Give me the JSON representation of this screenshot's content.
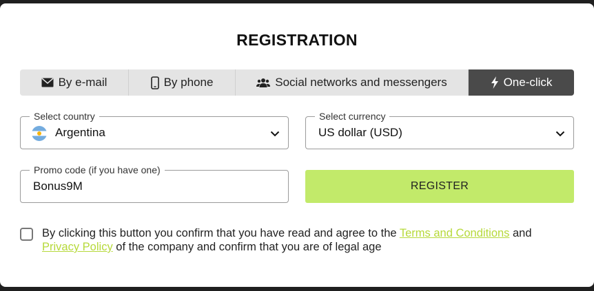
{
  "modal": {
    "title": "REGISTRATION"
  },
  "tabs": [
    {
      "label": "By e-mail",
      "icon": "envelope-icon"
    },
    {
      "label": "By phone",
      "icon": "phone-icon"
    },
    {
      "label": "Social networks and messengers",
      "icon": "users-icon"
    },
    {
      "label": "One-click",
      "icon": "lightning-icon",
      "active": true
    }
  ],
  "form": {
    "country": {
      "label": "Select country",
      "value": "Argentina",
      "flag": "argentina-flag-icon"
    },
    "currency": {
      "label": "Select currency",
      "value": "US dollar (USD)"
    },
    "promo": {
      "label": "Promo code (if you have one)",
      "value": "Bonus9M"
    },
    "register_label": "REGISTER"
  },
  "agreement": {
    "checked": false,
    "text_before": "By clicking this button you confirm that you have read and agree to the ",
    "terms_link": "Terms and Conditions",
    "text_and": " and ",
    "privacy_link": "Privacy Policy",
    "text_after": " of the company and confirm that you are of legal age"
  },
  "colors": {
    "accent": "#c2ea6a",
    "link": "#b6d93a",
    "active_tab": "#4a4a4a",
    "inactive_tab": "#e4e4e4"
  }
}
